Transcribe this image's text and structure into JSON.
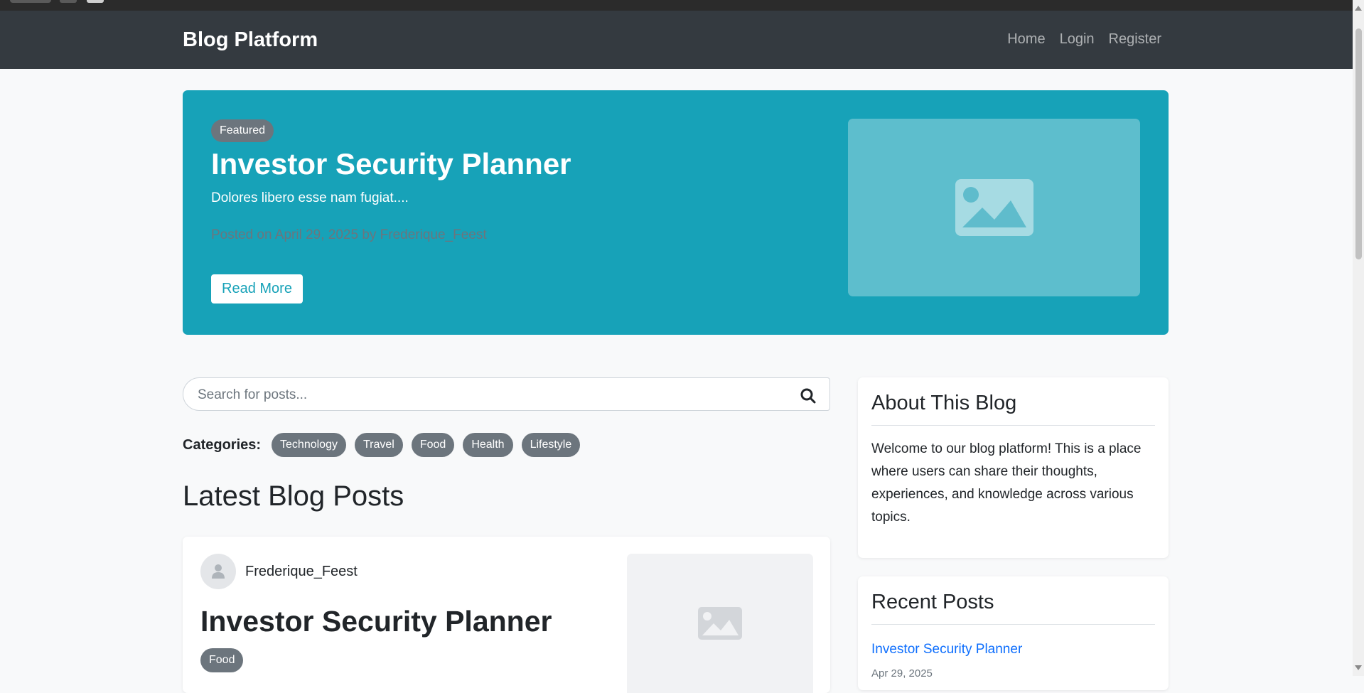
{
  "navbar": {
    "brand": "Blog Platform",
    "links": [
      "Home",
      "Login",
      "Register"
    ]
  },
  "hero": {
    "badge": "Featured",
    "title": "Investor Security Planner",
    "excerpt": "Dolores libero esse nam fugiat....",
    "meta": "Posted on April 29, 2025 by Frederique_Feest",
    "button": "Read More",
    "image_icon": "image-icon"
  },
  "search": {
    "placeholder": "Search for posts...",
    "icon": "search-icon"
  },
  "categories": {
    "label": "Categories:",
    "items": [
      "Technology",
      "Travel",
      "Food",
      "Health",
      "Lifestyle"
    ]
  },
  "latest": {
    "heading": "Latest Blog Posts",
    "posts": [
      {
        "author": "Frederique_Feest",
        "title": "Investor Security Planner",
        "category": "Food"
      }
    ]
  },
  "sidebar": {
    "about": {
      "title": "About This Blog",
      "text": "Welcome to our blog platform! This is a place where users can share their thoughts, experiences, and knowledge across various topics."
    },
    "recent": {
      "title": "Recent Posts",
      "items": [
        {
          "title": "Investor Security Planner",
          "date": "Apr 29, 2025"
        }
      ]
    }
  },
  "colors": {
    "navbar": "#343a40",
    "hero": "#17a2b8",
    "badge": "#6c757d",
    "link": "#0d6efd",
    "background": "#f8f9fa"
  }
}
